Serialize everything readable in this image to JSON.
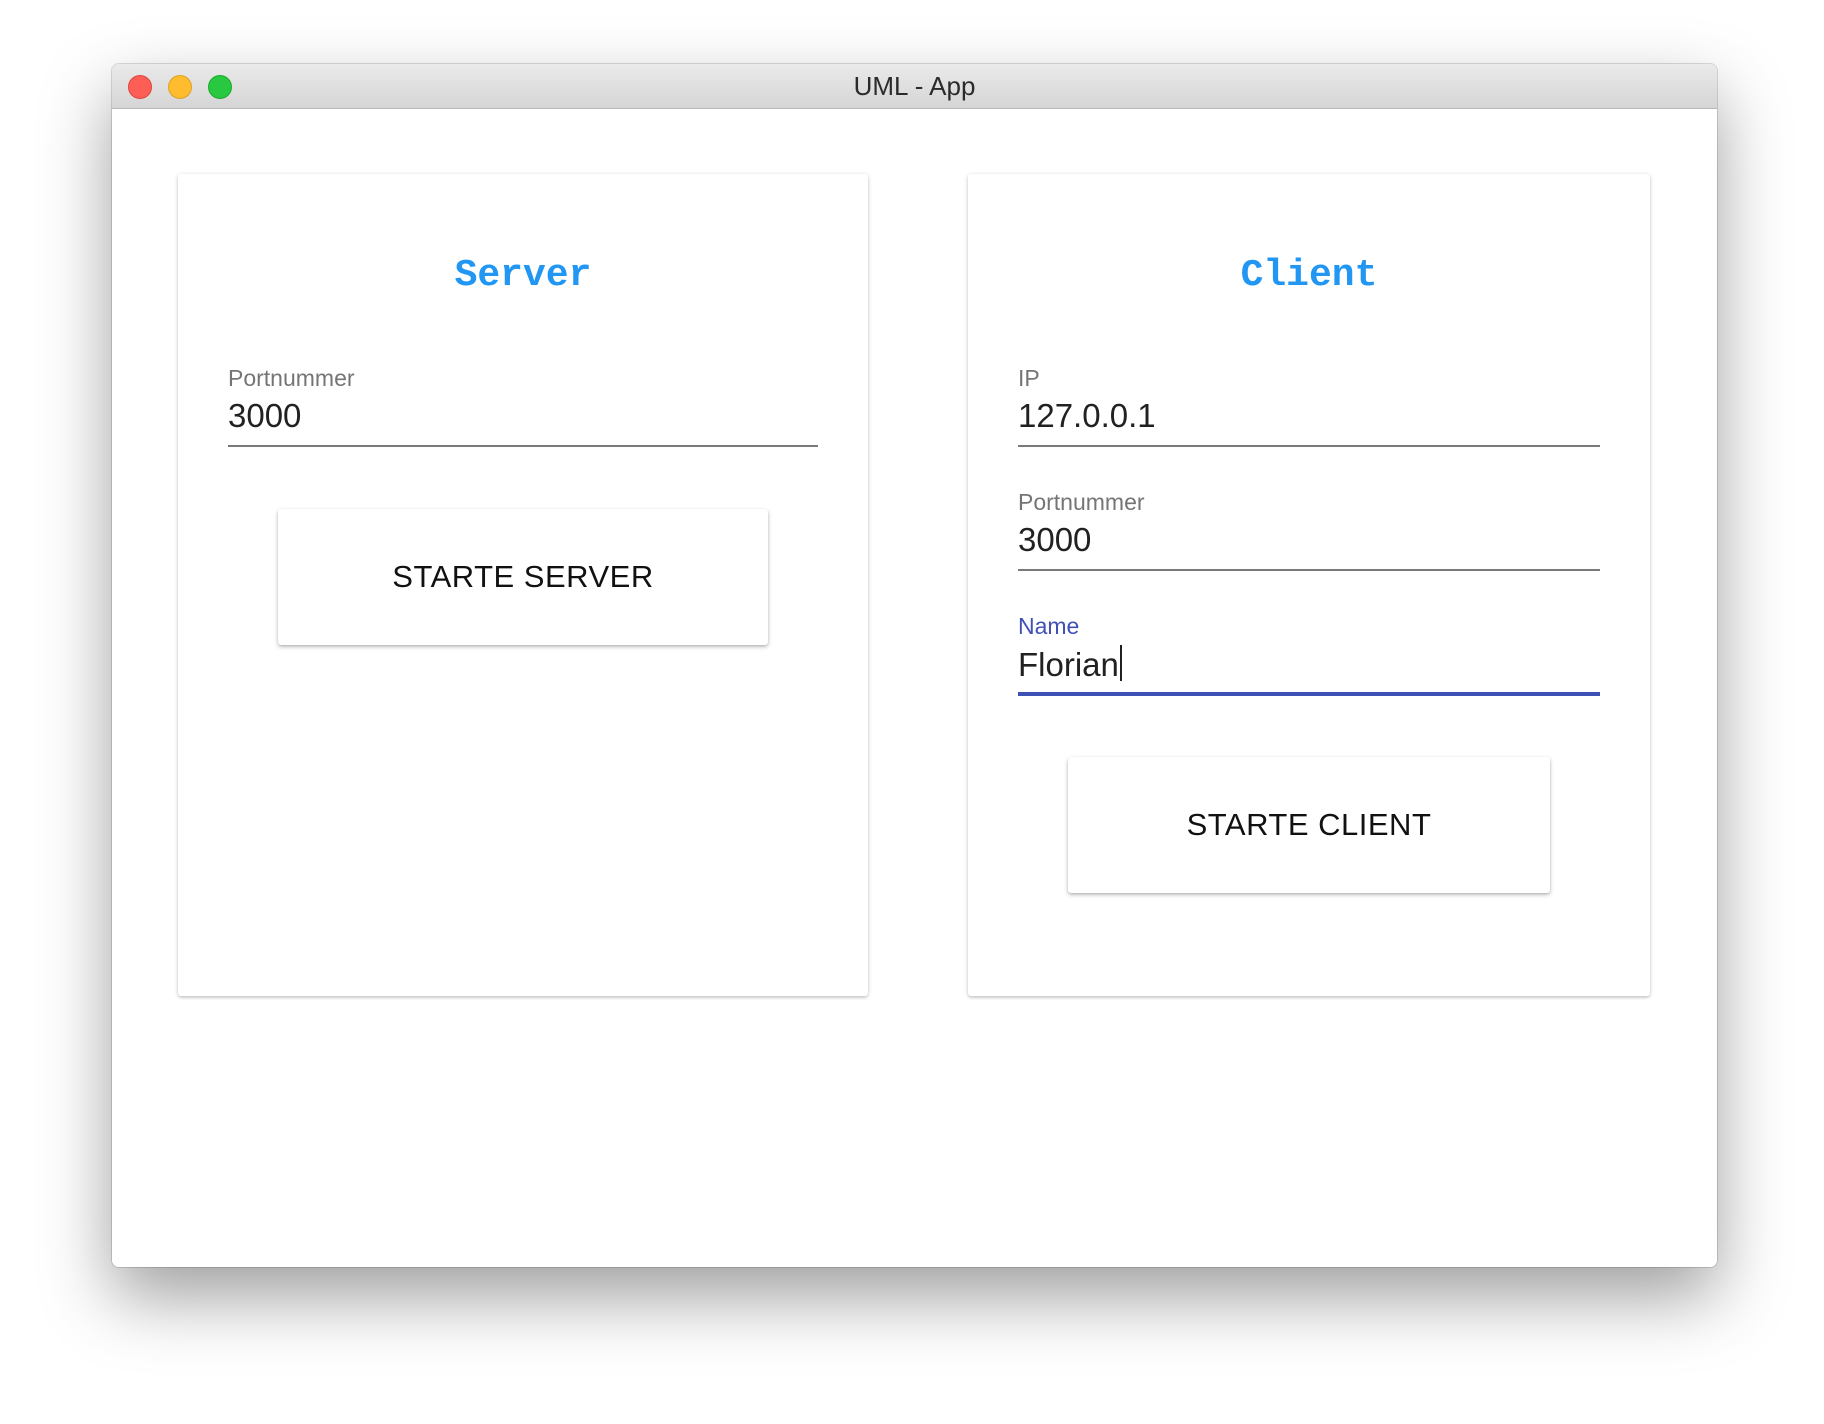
{
  "window": {
    "title": "UML - App"
  },
  "server": {
    "heading": "Server",
    "port_label": "Portnummer",
    "port_value": "3000",
    "start_button": "STARTE SERVER"
  },
  "client": {
    "heading": "Client",
    "ip_label": "IP",
    "ip_value": "127.0.0.1",
    "port_label": "Portnummer",
    "port_value": "3000",
    "name_label": "Name",
    "name_value": "Florian",
    "start_button": "STARTE CLIENT"
  },
  "colors": {
    "heading": "#2196f3",
    "focus_accent": "#3f51b5",
    "close": "#fd5f57",
    "minimize": "#febc2e",
    "maximize": "#28c840"
  }
}
